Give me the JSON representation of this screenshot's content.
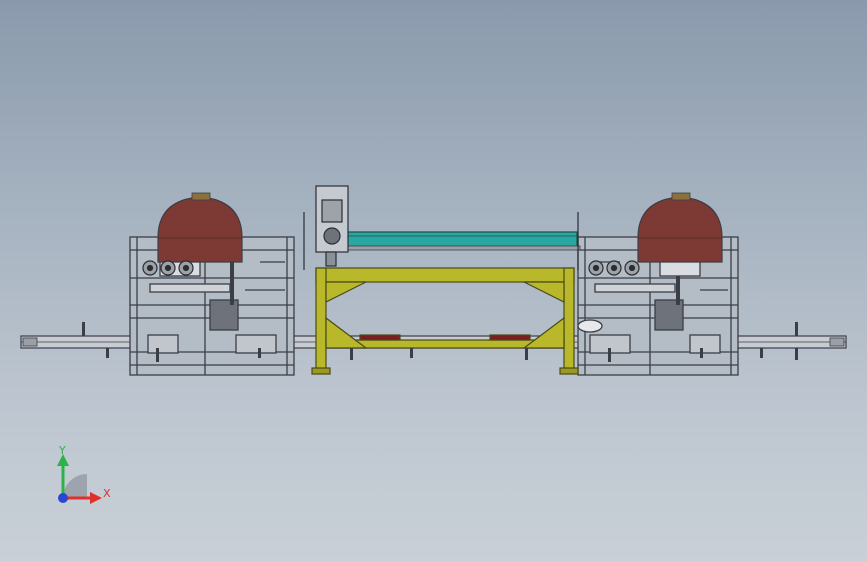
{
  "viewport": {
    "background_top": "#8a9aac",
    "background_bottom": "#c9d0d7"
  },
  "model": {
    "frame_color": "#3b3e45",
    "tank_color": "#7d3a34",
    "table_color": "#b8b82a",
    "belt_color": "#2aa7a0"
  },
  "triad": {
    "y_label": "Y",
    "x_label": "X",
    "y_color": "#2bb34a",
    "x_color": "#e0302a",
    "z_color": "#2b45d4"
  }
}
